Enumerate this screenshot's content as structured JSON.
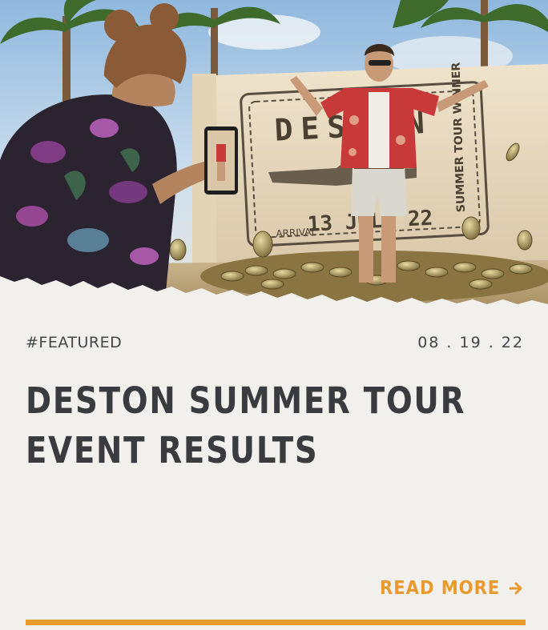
{
  "card": {
    "tag": "#FEATURED",
    "date": "08 . 19 . 22",
    "title_lines": [
      "DESTON SUMMER TOUR",
      "EVENT RESULTS"
    ],
    "read_more_label": "READ MORE",
    "arrow_icon": "arrow-right-icon"
  },
  "hero_image": {
    "stamp_text_main": "DESTON",
    "stamp_text_side": "SUMMER TOUR WINNER",
    "stamp_text_arrival": "ARRIVAL",
    "stamp_text_date": "13 JULY 22"
  },
  "colors": {
    "card_background": "#f1f0ed",
    "text_dark": "#3a3b3e",
    "accent_orange": "#e99a2c"
  }
}
